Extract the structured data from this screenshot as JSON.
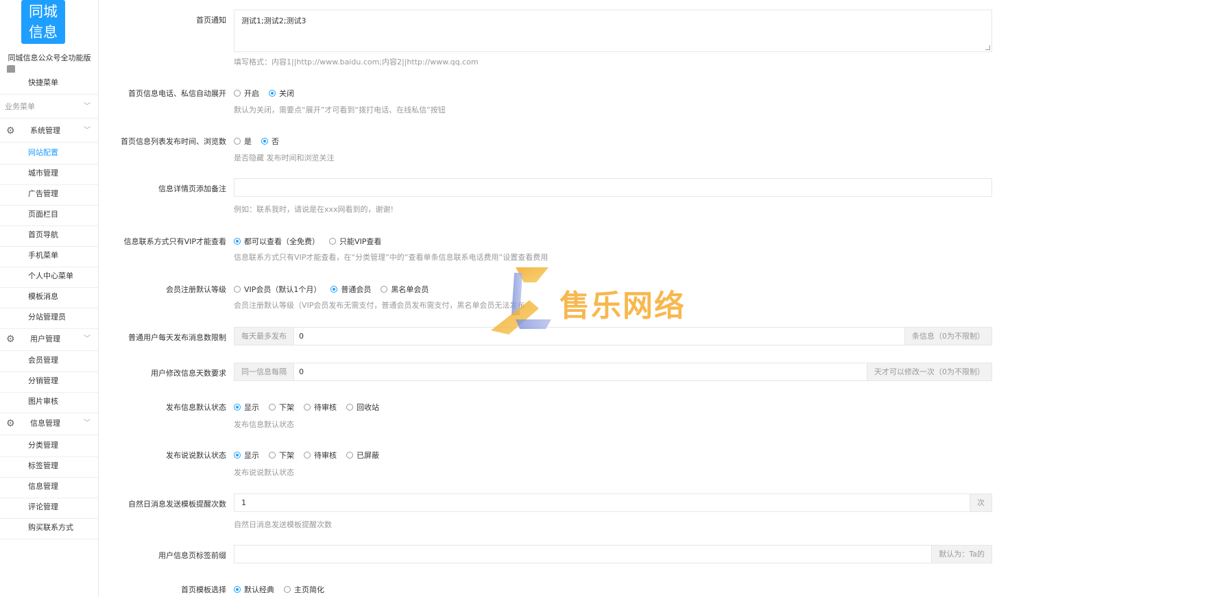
{
  "sidebar": {
    "logo_line1": "同城",
    "logo_line2": "信息",
    "site_name": "同城信息公众号全功能版",
    "items": [
      {
        "label": "快捷菜单"
      },
      {
        "label": "业务菜单"
      },
      {
        "label": "系统管理"
      },
      {
        "label": "网站配置"
      },
      {
        "label": "城市管理"
      },
      {
        "label": "广告管理"
      },
      {
        "label": "页面栏目"
      },
      {
        "label": "首页导航"
      },
      {
        "label": "手机菜单"
      },
      {
        "label": "个人中心菜单"
      },
      {
        "label": "模板消息"
      },
      {
        "label": "分站管理员"
      },
      {
        "label": "用户管理"
      },
      {
        "label": "会员管理"
      },
      {
        "label": "分销管理"
      },
      {
        "label": "图片审核"
      },
      {
        "label": "信息管理"
      },
      {
        "label": "分类管理"
      },
      {
        "label": "标签管理"
      },
      {
        "label": "信息管理"
      },
      {
        "label": "评论管理"
      },
      {
        "label": "购买联系方式"
      }
    ]
  },
  "form": {
    "notice": {
      "label": "首页通知",
      "value": "测试1;测试2;测试3",
      "hint": "填写格式：内容1||http://www.baidu.com;内容2||http://www.qq.com"
    },
    "auto_expand": {
      "label": "首页信息电话、私信自动展开",
      "options": [
        "开启",
        "关闭"
      ],
      "selected": "关闭",
      "hint": "默认为关闭，需要点“展开”才可看到“拨打电话、在线私信”按钮"
    },
    "list_time": {
      "label": "首页信息列表发布时间、浏览数",
      "options": [
        "是",
        "否"
      ],
      "selected": "否",
      "hint": "是否隐藏 发布时间和浏览关注"
    },
    "detail_note": {
      "label": "信息详情页添加备注",
      "value": "",
      "hint": "例如：联系我时，请说是在xxx网看到的，谢谢!"
    },
    "vip_contact": {
      "label": "信息联系方式只有VIP才能查看",
      "options": [
        "都可以查看（全免费）",
        "只能VIP查看"
      ],
      "selected": "都可以查看（全免费）",
      "hint": "信息联系方式只有VIP才能查看，在“分类管理”中的“查看单条信息联系电话费用”设置查看费用"
    },
    "member_level": {
      "label": "会员注册默认等级",
      "options": [
        "VIP会员（默认1个月）",
        "普通会员",
        "黑名单会员"
      ],
      "selected": "普通会员",
      "hint": "会员注册默认等级（VIP会员发布无需支付，普通会员发布需支付，黑名单会员无法发布"
    },
    "daily_limit": {
      "label": "普通用户每天发布消息数限制",
      "prefix": "每天最多发布",
      "value": "0",
      "suffix": "条信息（0为不限制）"
    },
    "edit_days": {
      "label": "用户修改信息天数要求",
      "prefix": "同一信息每隔",
      "value": "0",
      "suffix": "天才可以修改一次（0为不限制）"
    },
    "post_status": {
      "label": "发布信息默认状态",
      "options": [
        "显示",
        "下架",
        "待审核",
        "回收站"
      ],
      "selected": "显示",
      "hint": "发布信息默认状态"
    },
    "talk_status": {
      "label": "发布说说默认状态",
      "options": [
        "显示",
        "下架",
        "待审核",
        "已屏蔽"
      ],
      "selected": "显示",
      "hint": "发布说说默认状态"
    },
    "remind_times": {
      "label": "自然日消息发送模板提醒次数",
      "value": "1",
      "suffix": "次",
      "hint": "自然日消息发送模板提醒次数"
    },
    "tag_prefix": {
      "label": "用户信息页标签前缀",
      "value": "",
      "suffix": "默认为：Ta的"
    },
    "home_template": {
      "label": "首页模板选择",
      "options": [
        "默认经典",
        "主页简化"
      ],
      "selected": "默认经典"
    }
  },
  "watermark": {
    "text": "售乐网络"
  },
  "colors": {
    "accent": "#1e9fff",
    "watermark": "#f5a623"
  }
}
